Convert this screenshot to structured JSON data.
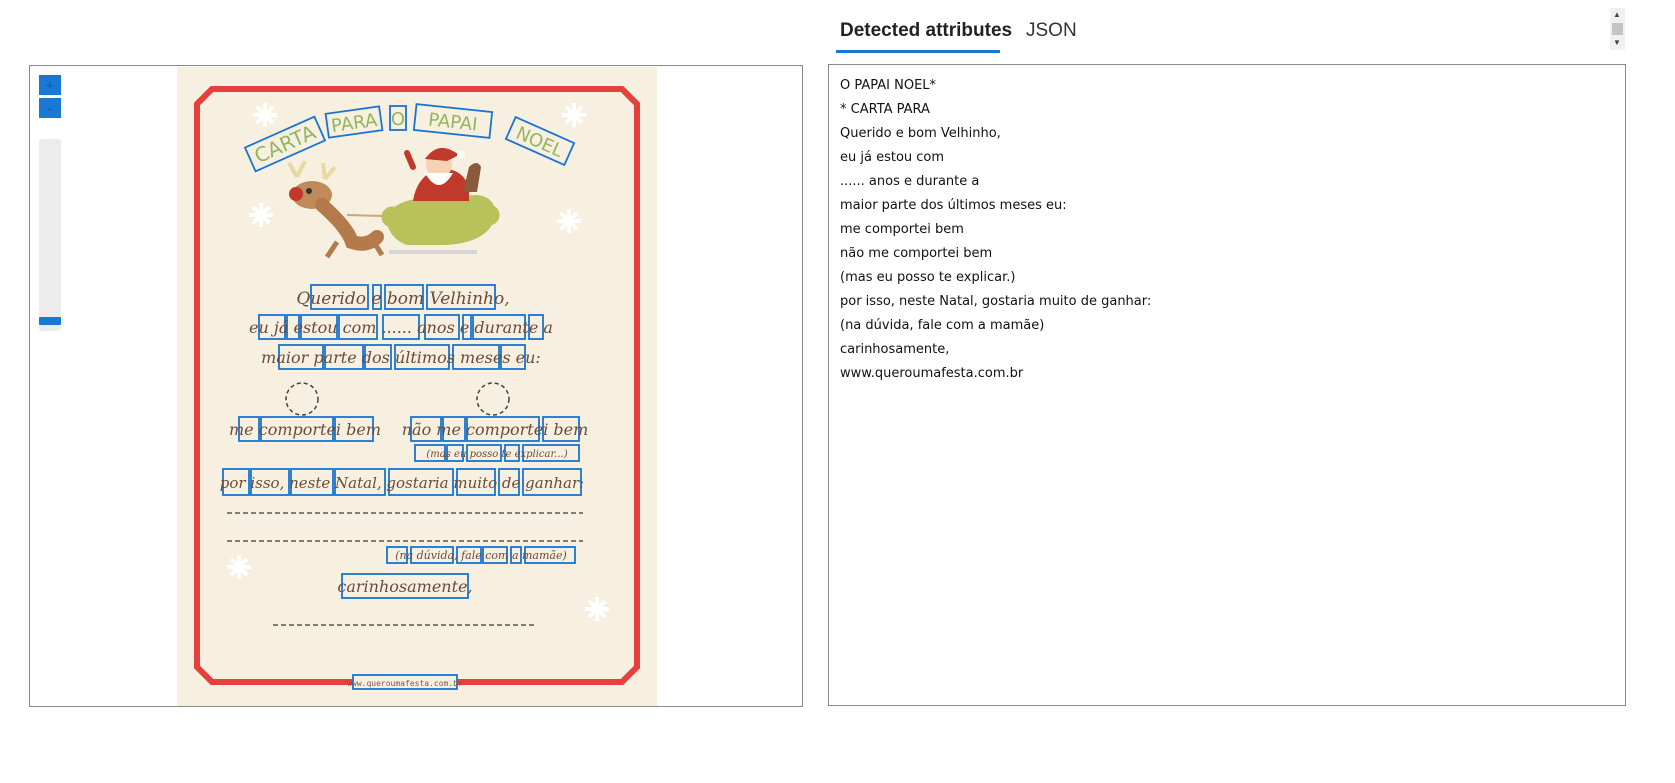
{
  "tabs": {
    "active": "Detected attributes",
    "json": "JSON"
  },
  "viewer": {
    "zoom_in": "+",
    "zoom_out": "-"
  },
  "document": {
    "title_words": [
      "CARTA",
      "PARA",
      "O",
      "PAPAI",
      "NOEL"
    ],
    "line1": "Querido e bom Velhinho,",
    "line2": "eu já estou com ...... anos e durante a",
    "line3": "maior parte dos últimos meses eu:",
    "opt1": "me comportei bem",
    "opt2": "não me comportei bem",
    "opt2_note": "(mas eu posso te explicar...)",
    "line4": "por isso, neste Natal, gostaria muito de ganhar:",
    "note": "(na dúvida, fale com a mamãe)",
    "closing": "carinhosamente,",
    "footer": "www.queroumafesta.com.br"
  },
  "attributes": [
    "O PAPAI NOEL*",
    "* CARTA PARA",
    "Querido e bom Velhinho,",
    "eu já estou com",
    "...... anos e durante a",
    "maior parte dos últimos meses eu:",
    "me comportei bem",
    "não me comportei bem",
    "(mas eu posso te explicar.)",
    "por isso, neste Natal, gostaria muito de ganhar:",
    "(na dúvida, fale com a mamãe)",
    "carinhosamente,",
    "www.queroumafesta.com.br"
  ],
  "colors": {
    "accent": "#1878d4",
    "frame": "#e5403c",
    "paper": "#f7efe0",
    "title_green": "#93b65e"
  }
}
